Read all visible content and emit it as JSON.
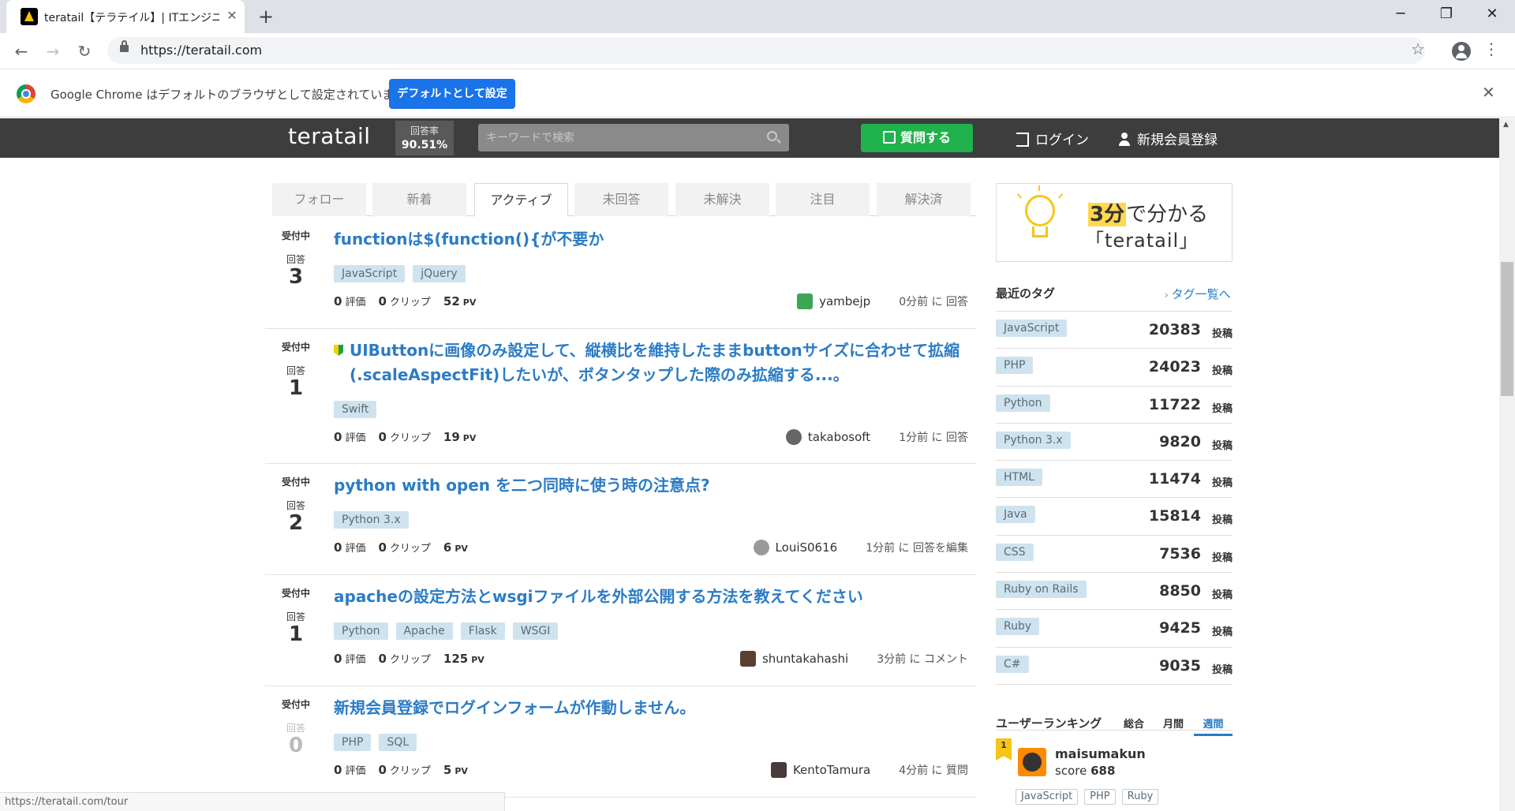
{
  "browser": {
    "tab_title": "teratail【テラテイル】| ITエンジニア特",
    "url": "https://teratail.com",
    "infobar_text": "Google Chrome はデフォルトのブラウザとして設定されていません",
    "infobar_button": "デフォルトとして設定",
    "status_url": "https://teratail.com/tour"
  },
  "header": {
    "logo": "teratail",
    "rate_label": "回答率",
    "rate_value": "90.51%",
    "search_placeholder": "キーワードで検索",
    "ask_label": "質問する",
    "login_label": "ログイン",
    "signup_label": "新規会員登録"
  },
  "tabs": [
    "フォロー",
    "新着",
    "アクティブ",
    "未回答",
    "未解決",
    "注目",
    "解決済"
  ],
  "active_tab": "アクティブ",
  "questions": [
    {
      "status": "受付中",
      "answer_label": "回答",
      "answers": "3",
      "title": "functionは$(function(){が不要か",
      "tags": [
        "JavaScript",
        "jQuery"
      ],
      "rating": "0",
      "rating_label": "評価",
      "clips": "0",
      "clip_label": "クリップ",
      "pv": "52",
      "pv_label": "PV",
      "author": "yambejp",
      "time": "0分前 に 回答"
    },
    {
      "status": "受付中",
      "answer_label": "回答",
      "answers": "1",
      "title": "UIButtonに画像のみ設定して、縦横比を維持したままbuttonサイズに合わせて拡縮(.scaleAspectFit)したいが、ボタンタップした際のみ拡縮する...。",
      "tags": [
        "Swift"
      ],
      "rating": "0",
      "rating_label": "評価",
      "clips": "0",
      "clip_label": "クリップ",
      "pv": "19",
      "pv_label": "PV",
      "author": "takabosoft",
      "time": "1分前 に 回答"
    },
    {
      "status": "受付中",
      "answer_label": "回答",
      "answers": "2",
      "title": "python with open を二つ同時に使う時の注意点?",
      "tags": [
        "Python 3.x"
      ],
      "rating": "0",
      "rating_label": "評価",
      "clips": "0",
      "clip_label": "クリップ",
      "pv": "6",
      "pv_label": "PV",
      "author": "LouiS0616",
      "time": "1分前 に 回答を編集"
    },
    {
      "status": "受付中",
      "answer_label": "回答",
      "answers": "1",
      "title": "apacheの設定方法とwsgiファイルを外部公開する方法を教えてください",
      "tags": [
        "Python",
        "Apache",
        "Flask",
        "WSGI"
      ],
      "rating": "0",
      "rating_label": "評価",
      "clips": "0",
      "clip_label": "クリップ",
      "pv": "125",
      "pv_label": "PV",
      "author": "shuntakahashi",
      "time": "3分前 に コメント"
    },
    {
      "status": "受付中",
      "answer_label": "回答",
      "answers": "0",
      "title": "新規会員登録でログインフォームが作動しません。",
      "tags": [
        "PHP",
        "SQL"
      ],
      "rating": "0",
      "rating_label": "評価",
      "clips": "0",
      "clip_label": "クリップ",
      "pv": "5",
      "pv_label": "PV",
      "author": "KentoTamura",
      "time": "4分前 に 質問"
    }
  ],
  "sidebar": {
    "banner_highlight": "3分",
    "banner_rest": "で分かる",
    "banner_line2": "「teratail」",
    "recent_tags_title": "最近のタグ",
    "tag_list_link": "タグ一覧へ",
    "tag_unit": "投稿",
    "recent_tags": [
      {
        "name": "JavaScript",
        "count": "20383"
      },
      {
        "name": "PHP",
        "count": "24023"
      },
      {
        "name": "Python",
        "count": "11722"
      },
      {
        "name": "Python 3.x",
        "count": "9820"
      },
      {
        "name": "HTML",
        "count": "11474"
      },
      {
        "name": "Java",
        "count": "15814"
      },
      {
        "name": "CSS",
        "count": "7536"
      },
      {
        "name": "Ruby on Rails",
        "count": "8850"
      },
      {
        "name": "Ruby",
        "count": "9425"
      },
      {
        "name": "C#",
        "count": "9035"
      }
    ],
    "ranking_title": "ユーザーランキング",
    "ranking_tabs": [
      "総合",
      "月間",
      "週間"
    ],
    "ranking_active": "週間",
    "top_user": {
      "rank": "1",
      "name": "maisumakun",
      "score_label": "score",
      "score": "688",
      "tags": [
        "JavaScript",
        "PHP",
        "Ruby"
      ]
    }
  },
  "colors": {
    "accent_blue": "#2b7cc5",
    "ask_green": "#20b24c",
    "header_dark": "#3d3d3d",
    "tag_bg": "#cfe3ef"
  }
}
